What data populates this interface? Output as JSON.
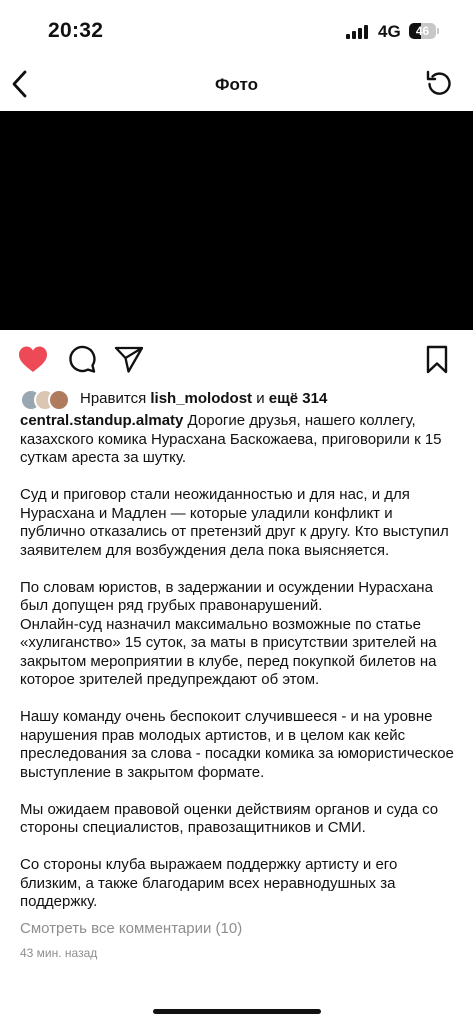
{
  "status_bar": {
    "time": "20:32",
    "network": "4G",
    "battery": "46",
    "battery_fraction": 0.46
  },
  "nav": {
    "title": "Фото"
  },
  "post": {
    "liked": true,
    "likes": {
      "prefix": "Нравится ",
      "user": "lish_molodost",
      "conjunction": " и ",
      "more": "ещё 314"
    },
    "author": "central.standup.almaty",
    "caption_lead": " Дорогие друзья, нашего коллегу, казахского комика Нурасхана Баскожаева, приговорили к 15 суткам ареста за шутку.",
    "paragraphs": [
      "Суд и приговор стали неожиданностью и для нас, и для Нурасхана и Мадлен — которые уладили конфликт и публично отказались от претензий друг к другу. Кто выступил заявителем для возбуждения дела пока выясняется.",
      "По словам юристов, в задержании и осуждении Нурасхана был допущен ряд грубых правонарушений.",
      "Онлайн-суд назначил максимально возможные по статье «хулиганство» 15 суток, за маты в присутствии зрителей на закрытом мероприятии в клубе, перед покупкой билетов на которое зрителей предупреждают об этом.",
      "Нашу команду очень беспокоит случившееся - и на уровне нарушения прав молодых артистов, и в целом как кейс преследования за слова - посадки комика за юмористическое выступление в закрытом формате.",
      "Мы ожидаем правовой оценки действиям органов и суда со стороны специалистов, правозащитников и СМИ.",
      "Со стороны клуба выражаем поддержку артисту и его близким, а также благодарим всех неравнодушных за поддержку."
    ],
    "view_comments": "Смотреть все комментарии (10)",
    "time_ago": "43 мин. назад"
  },
  "icons": {
    "back": "chevron-left-icon",
    "reload": "rotate-icon",
    "like": "heart-icon",
    "comment": "comment-icon",
    "share": "paper-plane-icon",
    "save": "bookmark-icon"
  },
  "colors": {
    "like": "#ed4956",
    "muted": "#8e8e8e"
  }
}
